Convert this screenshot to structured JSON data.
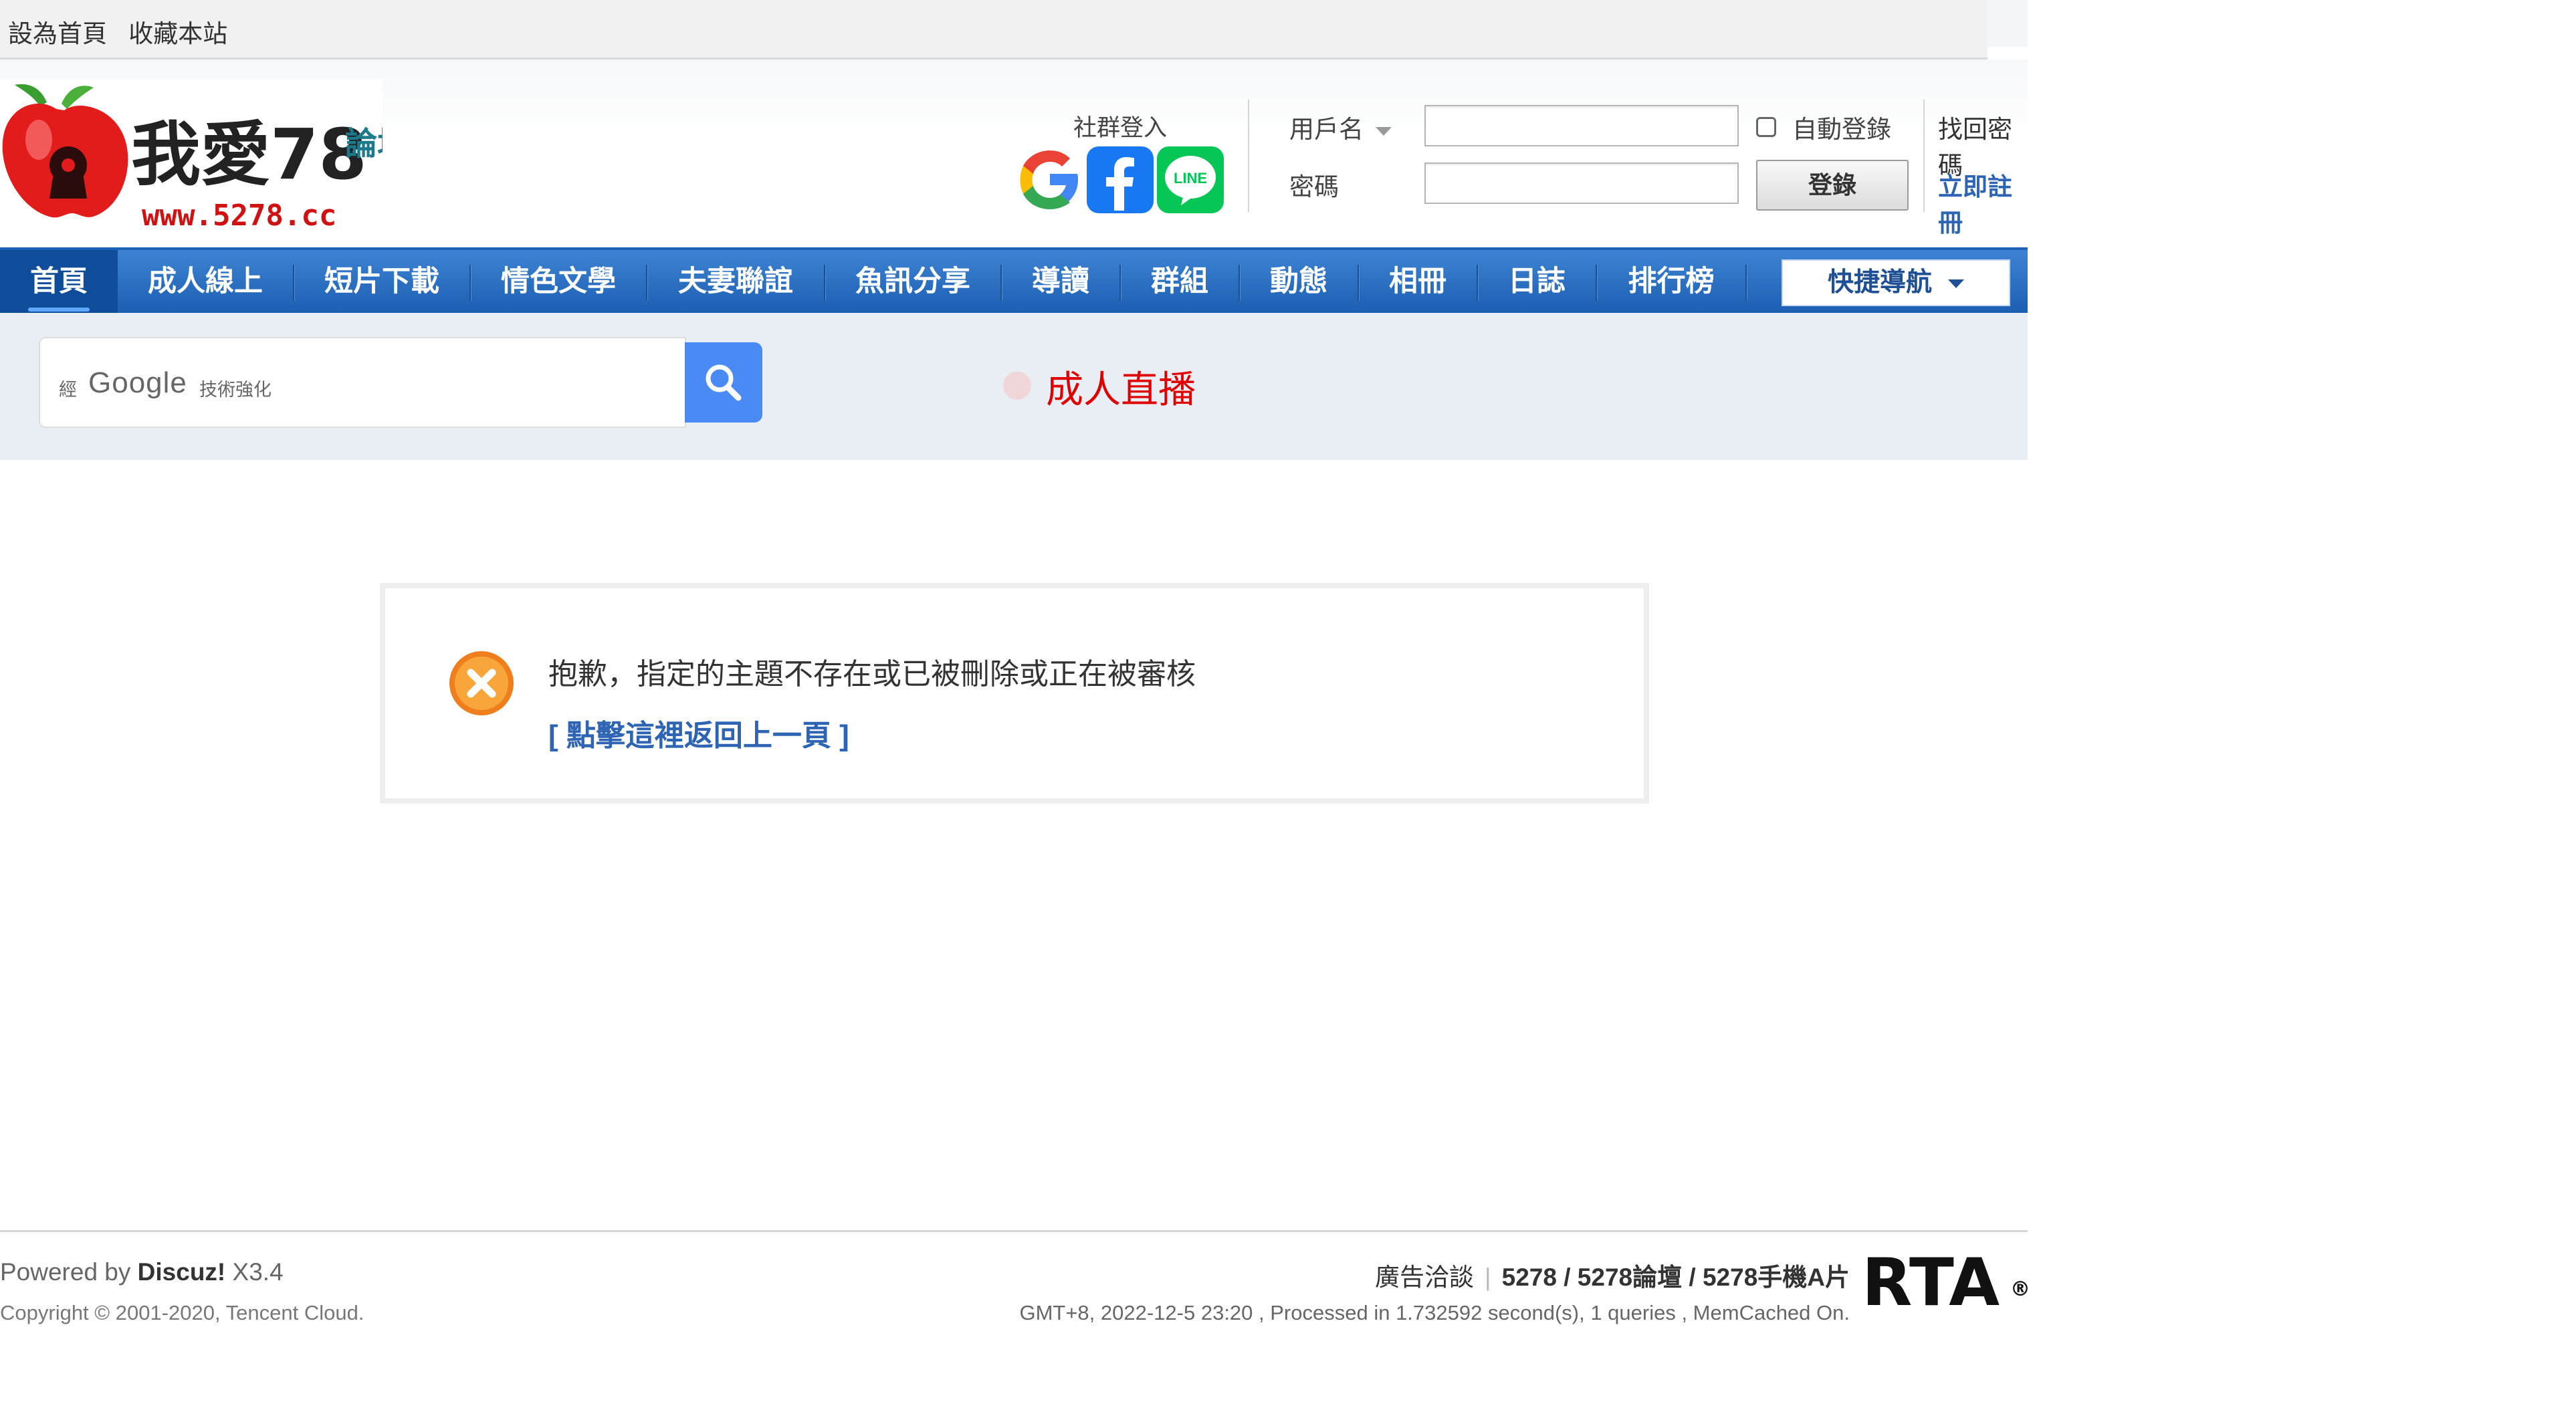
{
  "top_links": [
    "設為首頁",
    "收藏本站"
  ],
  "logo": {
    "domain_text": "www.5278.cc",
    "brand_text": "我愛78",
    "side_text": "論壇",
    "colors": {
      "apple": "#e21b1b",
      "leaf": "#3a9d2f",
      "text": "#222222",
      "domain": "#d11111"
    }
  },
  "social_login": {
    "title": "社群登入",
    "providers": [
      {
        "name": "Google",
        "icon": "google-icon"
      },
      {
        "name": "Facebook",
        "icon": "facebook-icon",
        "color": "#1877f2"
      },
      {
        "name": "LINE",
        "icon": "line-icon",
        "color": "#06c755",
        "label": "LINE"
      }
    ]
  },
  "login": {
    "username_label": "用戶名",
    "password_label": "密碼",
    "username_value": "",
    "password_value": "",
    "auto_login_label": "自動登錄",
    "auto_login_checked": false,
    "submit_label": "登錄",
    "forgot_password": "找回密碼",
    "register": "立即註冊"
  },
  "nav": {
    "items": [
      "首頁",
      "成人線上",
      "短片下載",
      "情色文學",
      "夫妻聯誼",
      "魚訊分享",
      "導讀",
      "群組",
      "動態",
      "相冊",
      "日誌",
      "排行榜"
    ],
    "active_index": 0,
    "quick_nav_label": "快捷導航"
  },
  "search": {
    "prefix": "經",
    "brand": "Google",
    "suffix": "技術強化",
    "value": ""
  },
  "live_link": "成人直播",
  "message": {
    "text": "抱歉，指定的主題不存在或已被刪除或正在被審核",
    "back_link": "[ 點擊這裡返回上一頁 ]"
  },
  "footer": {
    "powered_prefix": "Powered by",
    "powered_brand": "Discuz!",
    "powered_version": "X3.4",
    "copyright": "Copyright © 2001-2020, Tencent Cloud.",
    "ad_link": "廣告洽談",
    "site_links": "5278 / 5278論壇 / 5278手機A片",
    "meta": "GMT+8, 2022-12-5 23:20 , Processed in 1.732592 second(s), 1 queries , MemCached On.",
    "rta_text": "RTA",
    "rta_mark": "®"
  }
}
